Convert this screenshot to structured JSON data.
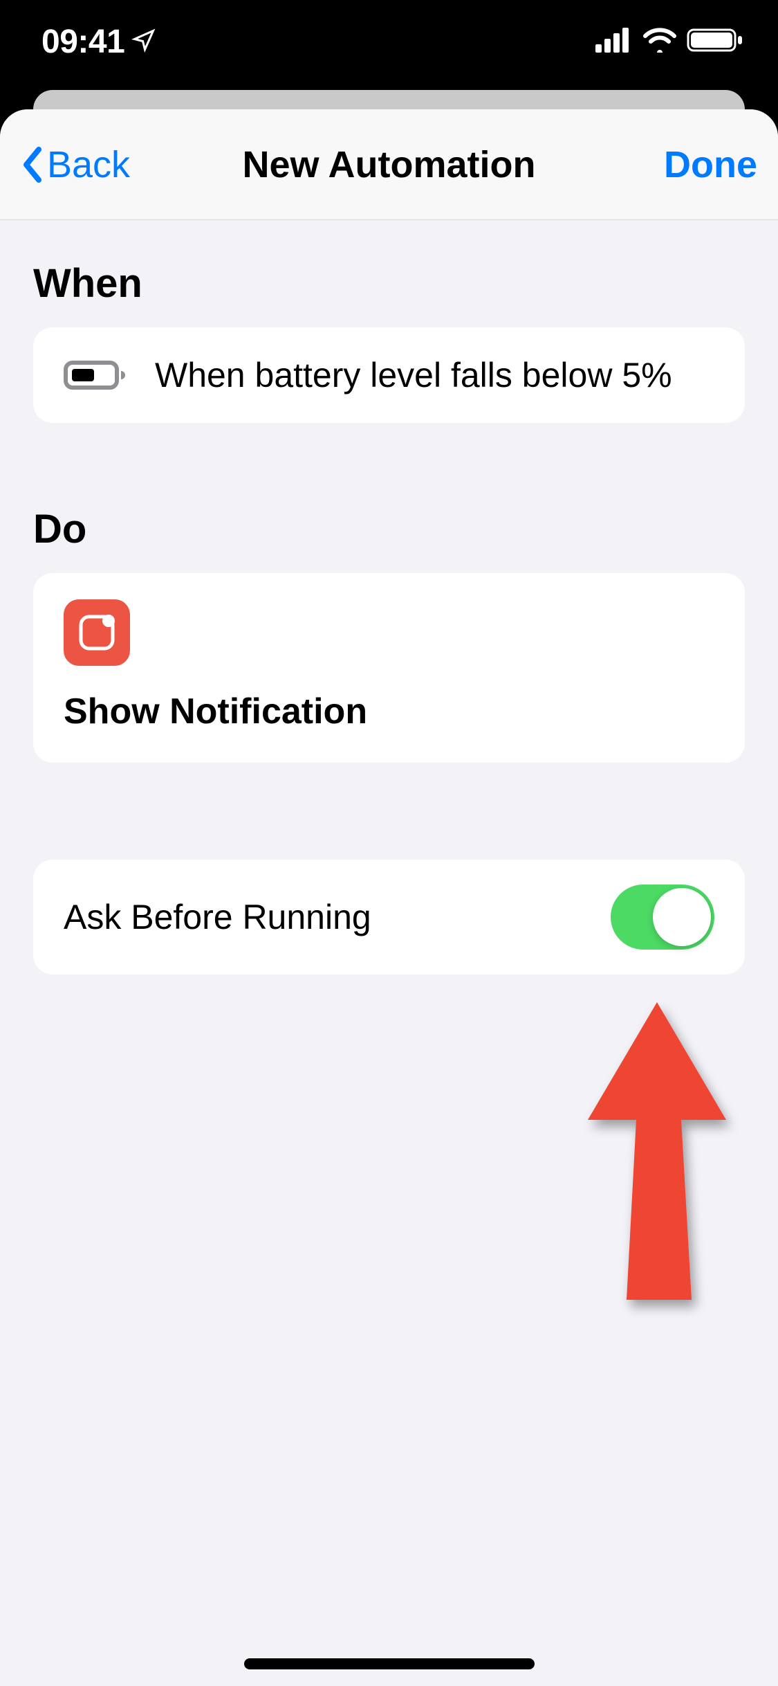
{
  "statusBar": {
    "time": "09:41"
  },
  "nav": {
    "back": "Back",
    "title": "New Automation",
    "done": "Done"
  },
  "sections": {
    "when": {
      "header": "When",
      "text": "When battery level falls below 5%"
    },
    "do": {
      "header": "Do",
      "action": "Show Notification"
    },
    "toggle": {
      "label": "Ask Before Running",
      "on": true
    }
  },
  "colors": {
    "accent": "#007aff",
    "toggleOn": "#4cd964",
    "appIcon": "#ec5443",
    "arrow": "#ee4632"
  }
}
